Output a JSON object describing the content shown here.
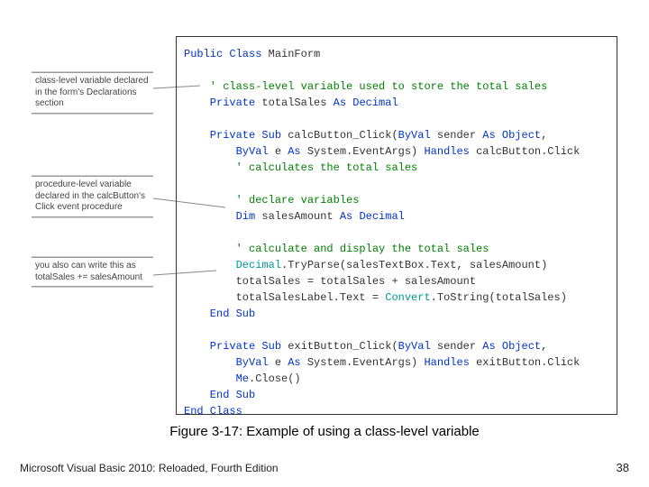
{
  "callouts": [
    "class-level variable declared in the form's Declarations section",
    "procedure-level variable declared in the calcButton's Click event procedure",
    "you also can write this as totalSales += salesAmount"
  ],
  "code": {
    "l1_a": "Public Class",
    "l1_b": " MainForm",
    "blank": "",
    "l3": "    ' class-level variable used to store the total sales",
    "l4_a": "    Private",
    "l4_b": " totalSales ",
    "l4_c": "As Decimal",
    "l6_a": "    Private Sub",
    "l6_b": " calcButton_Click(",
    "l6_c": "ByVal",
    "l6_d": " sender ",
    "l6_e": "As Object",
    "l6_f": ",",
    "l7_a": "        ByVal",
    "l7_b": " e ",
    "l7_c": "As",
    "l7_d": " System.EventArgs) ",
    "l7_e": "Handles",
    "l7_f": " calcButton.Click",
    "l8": "        ' calculates the total sales",
    "l10": "        ' declare variables",
    "l11_a": "        Dim",
    "l11_b": " salesAmount ",
    "l11_c": "As Decimal",
    "l13": "        ' calculate and display the total sales",
    "l14_a": "        Decimal",
    "l14_b": ".TryParse(salesTextBox.Text, salesAmount)",
    "l15": "        totalSales = totalSales + salesAmount",
    "l16_a": "        totalSalesLabel.Text = ",
    "l16_b": "Convert",
    "l16_c": ".ToString(totalSales)",
    "l17": "    End Sub",
    "l19_a": "    Private Sub",
    "l19_b": " exitButton_Click(",
    "l19_c": "ByVal",
    "l19_d": " sender ",
    "l19_e": "As Object",
    "l19_f": ",",
    "l20_a": "        ByVal",
    "l20_b": " e ",
    "l20_c": "As",
    "l20_d": " System.EventArgs) ",
    "l20_e": "Handles",
    "l20_f": " exitButton.Click",
    "l21_a": "        Me",
    "l21_b": ".Close()",
    "l22": "    End Sub",
    "l23": "End Class"
  },
  "caption": "Figure 3-17: Example of using a class-level variable",
  "footer_left": "Microsoft Visual Basic 2010: Reloaded, Fourth Edition",
  "footer_right": "38"
}
